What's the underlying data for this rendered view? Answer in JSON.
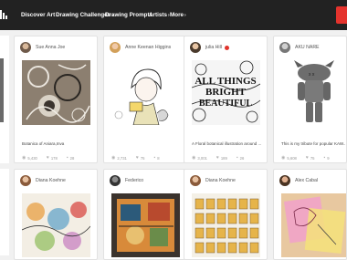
{
  "nav": {
    "items": [
      {
        "label": "Discover Art",
        "chev": "›"
      },
      {
        "label": "Drawing Challenges",
        "chev": "›"
      },
      {
        "label": "Drawing Prompts",
        "chev": ""
      },
      {
        "label": "Artists",
        "chev": "›"
      },
      {
        "label": "More",
        "chev": "›"
      }
    ]
  },
  "colors": {
    "topbar": "#222222",
    "accent": "#e4332d",
    "background": "#f1f1f1"
  },
  "cards": [
    {
      "user": "Sue Anna Joe",
      "desc": "Botanica of Aniara,Inva",
      "views": "5,430",
      "likes": "178",
      "comments": "28"
    },
    {
      "user": "Anne Keenan Higgins",
      "desc": "",
      "views": "2,731",
      "likes": "75",
      "comments": "8"
    },
    {
      "user": "julia Hill",
      "desc": "A Floral botanical illustration around ...",
      "views": "3,001",
      "likes": "189",
      "comments": "26"
    },
    {
      "user": "AKU NARE",
      "desc": "This is my tribute for popular KAW...",
      "views": "5,608",
      "likes": "75",
      "comments": "9"
    },
    {
      "user": "Diana Koehne"
    },
    {
      "user": "Federico"
    },
    {
      "user": "Diana Koehne"
    },
    {
      "user": "Alex Cabal"
    }
  ],
  "icons": {
    "views": "eye-icon",
    "likes": "heart-icon",
    "comments": "comment-icon"
  }
}
